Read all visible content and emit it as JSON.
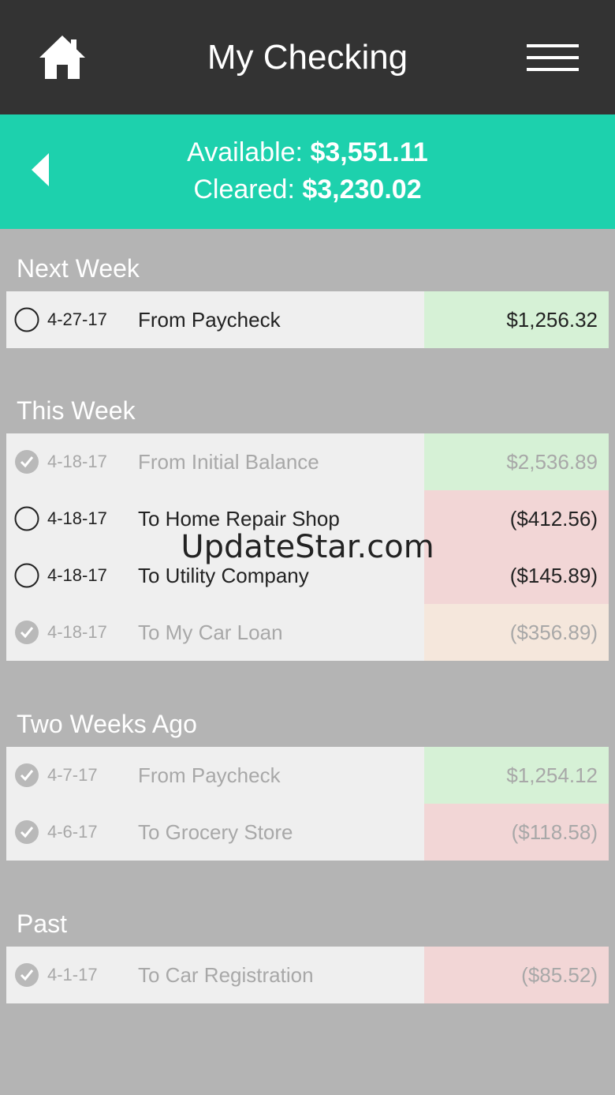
{
  "header": {
    "title": "My Checking",
    "home_icon": "home-icon",
    "menu_icon": "hamburger-menu-icon"
  },
  "balances": {
    "back_icon": "back-arrow-icon",
    "available_label": "Available:",
    "available_value": "$3,551.11",
    "cleared_label": "Cleared:",
    "cleared_value": "$3,230.02"
  },
  "colors": {
    "topbar": "#333333",
    "accent": "#1dd1ad",
    "income": "#d6f1d6",
    "expense": "#f2d6d6",
    "pending_expense": "#f5e7dc"
  },
  "sections": [
    {
      "title": "Next Week",
      "rows": [
        {
          "date": "4-27-17",
          "description": "From Paycheck",
          "amount": "$1,256.32",
          "cleared": false,
          "kind": "green"
        }
      ]
    },
    {
      "title": "This Week",
      "rows": [
        {
          "date": "4-18-17",
          "description": "From Initial Balance",
          "amount": "$2,536.89",
          "cleared": true,
          "kind": "green"
        },
        {
          "date": "4-18-17",
          "description": "To Home Repair Shop",
          "amount": "($412.56)",
          "cleared": false,
          "kind": "red"
        },
        {
          "date": "4-18-17",
          "description": "To Utility Company",
          "amount": "($145.89)",
          "cleared": false,
          "kind": "red"
        },
        {
          "date": "4-18-17",
          "description": "To My Car Loan",
          "amount": "($356.89)",
          "cleared": true,
          "kind": "peach"
        }
      ]
    },
    {
      "title": "Two Weeks Ago",
      "rows": [
        {
          "date": "4-7-17",
          "description": "From Paycheck",
          "amount": "$1,254.12",
          "cleared": true,
          "kind": "green"
        },
        {
          "date": "4-6-17",
          "description": "To Grocery Store",
          "amount": "($118.58)",
          "cleared": true,
          "kind": "red"
        }
      ]
    },
    {
      "title": "Past",
      "rows": [
        {
          "date": "4-1-17",
          "description": "To Car Registration",
          "amount": "($85.52)",
          "cleared": true,
          "kind": "red"
        }
      ]
    }
  ],
  "watermark": "UpdateStar.com"
}
